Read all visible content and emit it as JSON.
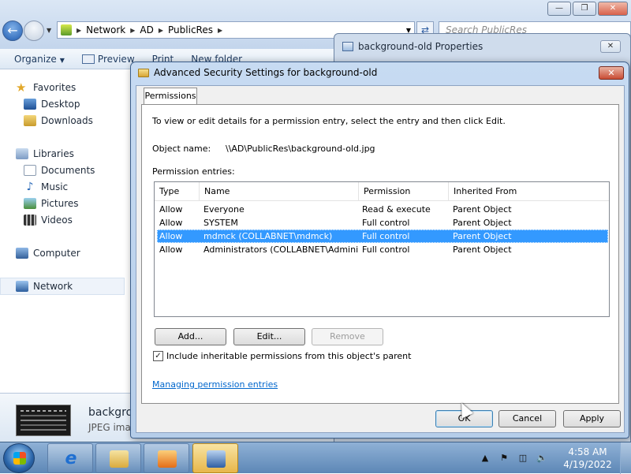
{
  "explorer": {
    "breadcrumb": [
      "Network",
      "AD",
      "PublicRes"
    ],
    "search_placeholder": "Search PublicRes",
    "toolbar": [
      "Organize",
      "Preview",
      "Print",
      "New folder"
    ],
    "nav": {
      "favorites": "Favorites",
      "desktop": "Desktop",
      "downloads": "Downloads",
      "libraries": "Libraries",
      "documents": "Documents",
      "music": "Music",
      "pictures": "Pictures",
      "videos": "Videos",
      "computer": "Computer",
      "network": "Network"
    },
    "details": {
      "name": "backgrou",
      "type": "JPEG imag"
    }
  },
  "properties_window": {
    "title": "background-old Properties"
  },
  "dialog": {
    "title": "Advanced Security Settings for background-old",
    "tab": "Permissions",
    "intro": "To view or edit details for a permission entry, select the entry and then click Edit.",
    "object_label": "Object name:",
    "object_value": "\\\\AD\\PublicRes\\background-old.jpg",
    "entries_label": "Permission entries:",
    "columns": [
      "Type",
      "Name",
      "Permission",
      "Inherited From"
    ],
    "rows": [
      {
        "type": "Allow",
        "name": "Everyone",
        "permission": "Read & execute",
        "inherited": "Parent Object"
      },
      {
        "type": "Allow",
        "name": "SYSTEM",
        "permission": "Full control",
        "inherited": "Parent Object"
      },
      {
        "type": "Allow",
        "name": "mdmck (COLLABNET\\mdmck)",
        "permission": "Full control",
        "inherited": "Parent Object"
      },
      {
        "type": "Allow",
        "name": "Administrators (COLLABNET\\Administ...",
        "permission": "Full control",
        "inherited": "Parent Object"
      }
    ],
    "selected_row": 2,
    "buttons": {
      "add": "Add...",
      "edit": "Edit...",
      "remove": "Remove"
    },
    "checkbox_label": "Include inheritable permissions from this object's parent",
    "checkbox_checked": true,
    "link": "Managing permission entries",
    "footer": {
      "ok": "OK",
      "cancel": "Cancel",
      "apply": "Apply"
    }
  },
  "taskbar": {
    "time": "4:58 AM",
    "date": "4/19/2022"
  },
  "colors": {
    "selection": "#3399ff",
    "link": "#0066cc",
    "title_close": "#c94c34"
  }
}
